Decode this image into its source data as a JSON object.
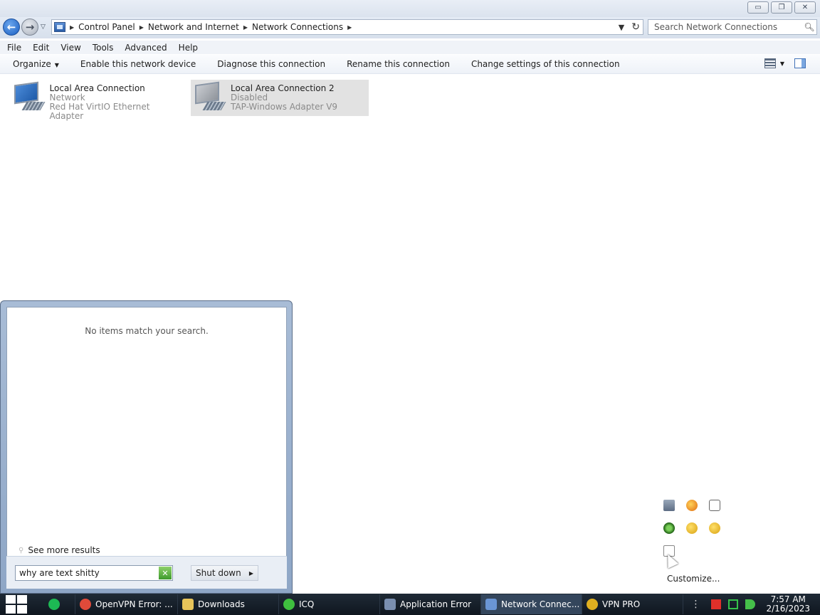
{
  "window": {
    "minimize_label": "▭",
    "maximize_label": "❐",
    "close_label": "✕"
  },
  "address": {
    "breadcrumbs": [
      "Control Panel",
      "Network and Internet",
      "Network Connections"
    ],
    "search_placeholder": "Search Network Connections"
  },
  "menubar": [
    "File",
    "Edit",
    "View",
    "Tools",
    "Advanced",
    "Help"
  ],
  "commands": {
    "organize": "Organize",
    "enable": "Enable this network device",
    "diagnose": "Diagnose this connection",
    "rename": "Rename this connection",
    "change": "Change settings of this connection"
  },
  "connections": [
    {
      "name": "Local Area Connection",
      "status": "Network",
      "adapter": "Red Hat VirtIO Ethernet Adapter",
      "selected": false
    },
    {
      "name": "Local Area Connection 2",
      "status": "Disabled",
      "adapter": "TAP-Windows Adapter V9",
      "selected": true
    }
  ],
  "start_menu": {
    "no_results": "No items match your search.",
    "see_more": "See more results",
    "search_value": "why are text shitty",
    "shutdown_label": "Shut down"
  },
  "tray_popup": {
    "customize": "Customize..."
  },
  "taskbar": {
    "tasks": [
      {
        "label": "OpenVPN Error: ...",
        "icon": "chrome-icon",
        "color": "#e04a3a"
      },
      {
        "label": "Downloads",
        "icon": "folder-icon",
        "color": "#e8c45a"
      },
      {
        "label": "ICQ",
        "icon": "icq-icon",
        "color": "#3fbf3f"
      },
      {
        "label": "Application Error",
        "icon": "app-error-icon",
        "color": "#7a8fb0"
      },
      {
        "label": "Network Connec...",
        "icon": "network-connections-icon",
        "color": "#6a95d4"
      },
      {
        "label": "VPN PRO",
        "icon": "vpn-pro-icon",
        "color": "#e0b020"
      }
    ],
    "time": "7:57 AM",
    "date": "2/16/2023"
  }
}
